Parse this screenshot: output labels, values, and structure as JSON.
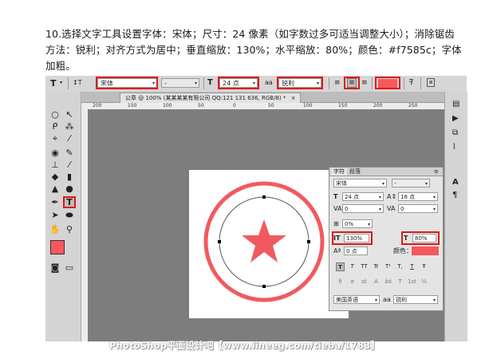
{
  "instruction": {
    "line1": "10.选择文字工具设置字体：宋体；尺寸：24 像素（如字数过多可适当调整大小）；消除锯齿",
    "line2": "方法：锐利；对齐方式为居中；垂直缩放：130%；水平缩放：80%；颜色：#f7585c；字体",
    "line3": "加粗。"
  },
  "options_bar": {
    "tool_icon": "T",
    "orient_icon": "↕T",
    "font_family": "宋体",
    "font_style": "-",
    "size_icon": "T",
    "font_size": "24 点",
    "aa_label": "aa",
    "antialias": "锐利",
    "color": "#f7585c"
  },
  "tabs": {
    "document": "公章 @ 100% (某某某某有限公司 QQ:121 131 636, RGB/8) *",
    "close": "×"
  },
  "ruler": {
    "ticks": [
      "200",
      "150",
      "100",
      "50",
      "0",
      "50",
      "100",
      "150",
      "200",
      "250",
      "300"
    ]
  },
  "tools": {
    "items": [
      "○",
      "↖",
      "☐",
      "⌖",
      "✂",
      "✎",
      "✍",
      "⎚",
      "▲",
      "◑",
      "✒",
      "T",
      "↖",
      "▭",
      "✋",
      "🔍"
    ]
  },
  "panel": {
    "tab_character": "字符",
    "tab_paragraph": "段落",
    "menu": "≡",
    "font_family": "宋体",
    "font_style": "-",
    "font_size": "24 点",
    "leading": "18 点",
    "kerning": "0",
    "tracking": "0",
    "baseline_pct": "0%",
    "vertical_scale": "130%",
    "horizontal_scale": "80%",
    "baseline_shift": "0 点",
    "color_label": "颜色：",
    "color": "#f7585c",
    "style_buttons": [
      "T",
      "T",
      "TT",
      "Tr",
      "T¹",
      "T,",
      "T",
      "Ŧ"
    ],
    "ot_buttons": [
      "fi",
      "σ",
      "st",
      "A",
      "ād",
      "T",
      "1st",
      "½"
    ],
    "language": "美国英语",
    "aa_label": "aa",
    "antialias": "锐利"
  },
  "watermark": "PhotoShop平面设计吧【www.lineeg.com/tieba/1783】"
}
